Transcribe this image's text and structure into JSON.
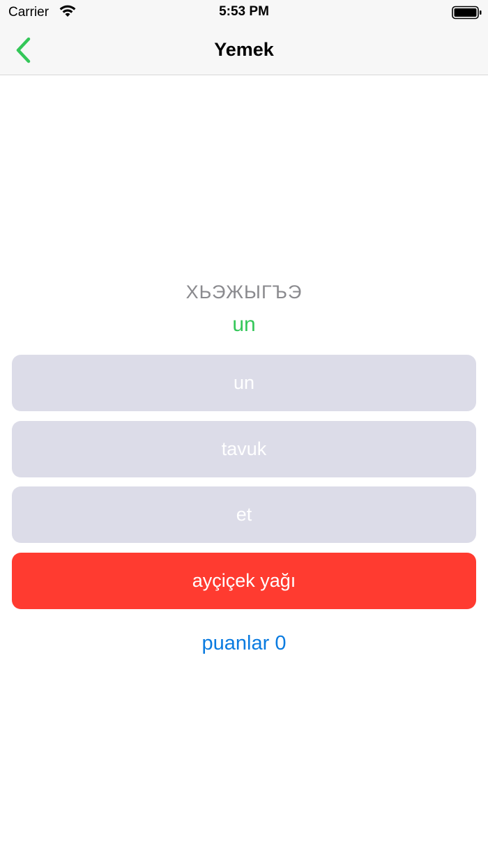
{
  "status_bar": {
    "carrier": "Carrier",
    "time": "5:53 PM",
    "wifi_icon": "wifi-icon",
    "battery_icon": "battery-icon"
  },
  "nav": {
    "title": "Yemek",
    "back_icon": "chevron-left-icon"
  },
  "quiz": {
    "question": "ХЬЭЖЫГЪЭ",
    "answer": "un",
    "options": [
      {
        "label": "un",
        "state": "neutral"
      },
      {
        "label": "tavuk",
        "state": "neutral"
      },
      {
        "label": "et",
        "state": "neutral"
      },
      {
        "label": "ayçiçek yağı",
        "state": "wrong"
      }
    ],
    "score_label": "puanlar 0"
  },
  "colors": {
    "accent_green": "#34c759",
    "wrong_red": "#ff3b30",
    "neutral_option": "#dcdce8",
    "link_blue": "#0a7be0",
    "question_gray": "#8a8a8e"
  }
}
